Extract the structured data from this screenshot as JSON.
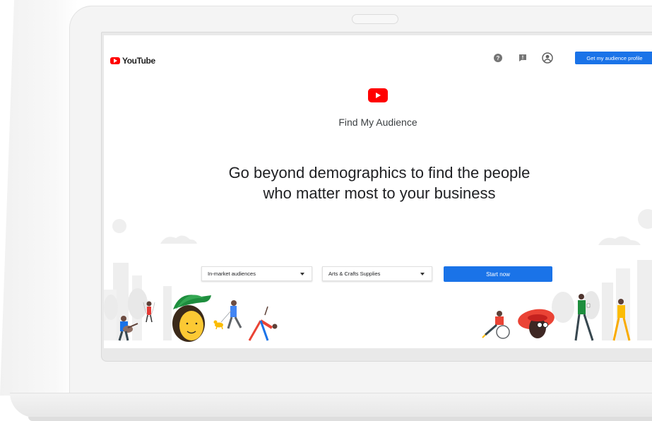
{
  "header": {
    "logo_text": "YouTube",
    "help_icon": "help-circle-icon",
    "feedback_icon": "feedback-icon",
    "account_icon": "account-circle-icon",
    "cta_label": "Get my audience profile"
  },
  "hero": {
    "product_name": "Find My Audience",
    "headline": "Go beyond demographics to find the people who matter most to your business"
  },
  "form": {
    "audience_type_selected": "In-market audiences",
    "category_selected": "Arts & Crafts Supplies",
    "start_label": "Start now"
  },
  "colors": {
    "brand_red": "#ff0000",
    "accent_blue": "#1a73e8"
  }
}
